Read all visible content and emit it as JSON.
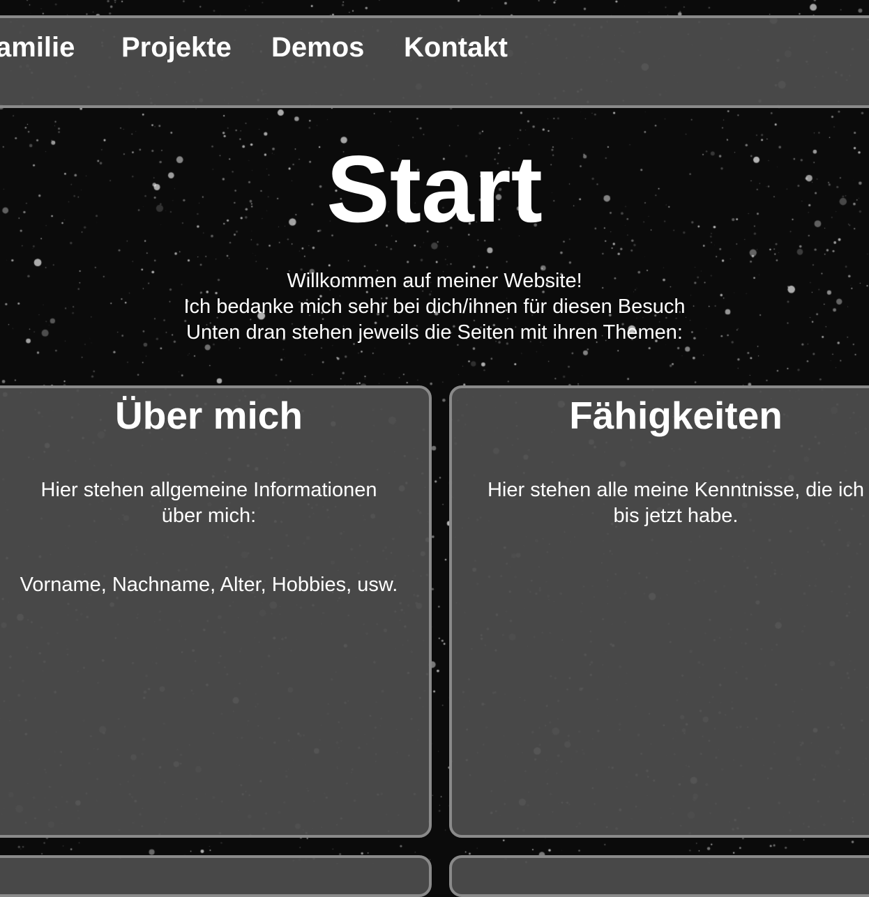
{
  "nav": {
    "items": [
      {
        "label": "amilie"
      },
      {
        "label": "Projekte"
      },
      {
        "label": "Demos"
      },
      {
        "label": "Kontakt"
      }
    ]
  },
  "hero": {
    "title": "Start",
    "lines": [
      "Willkommen auf meiner Website!",
      "Ich bedanke mich sehr bei dich/ihnen für diesen Besuch",
      "Unten dran stehen jeweils die Seiten mit ihren Themen:"
    ]
  },
  "cards": [
    {
      "title": "Über mich",
      "text_lines": [
        "Hier stehen allgemeine Informationen",
        "über mich:"
      ],
      "extra": "Vorname, Nachname, Alter, Hobbies, usw."
    },
    {
      "title": "Fähigkeiten",
      "text_lines": [
        "Hier stehen alle meine Kenntnisse, die ich",
        "bis jetzt habe."
      ]
    }
  ],
  "colors": {
    "background": "#0b0b0b",
    "panel": "#4e4e4e",
    "border": "#8a8a8a",
    "text": "#ffffff"
  }
}
